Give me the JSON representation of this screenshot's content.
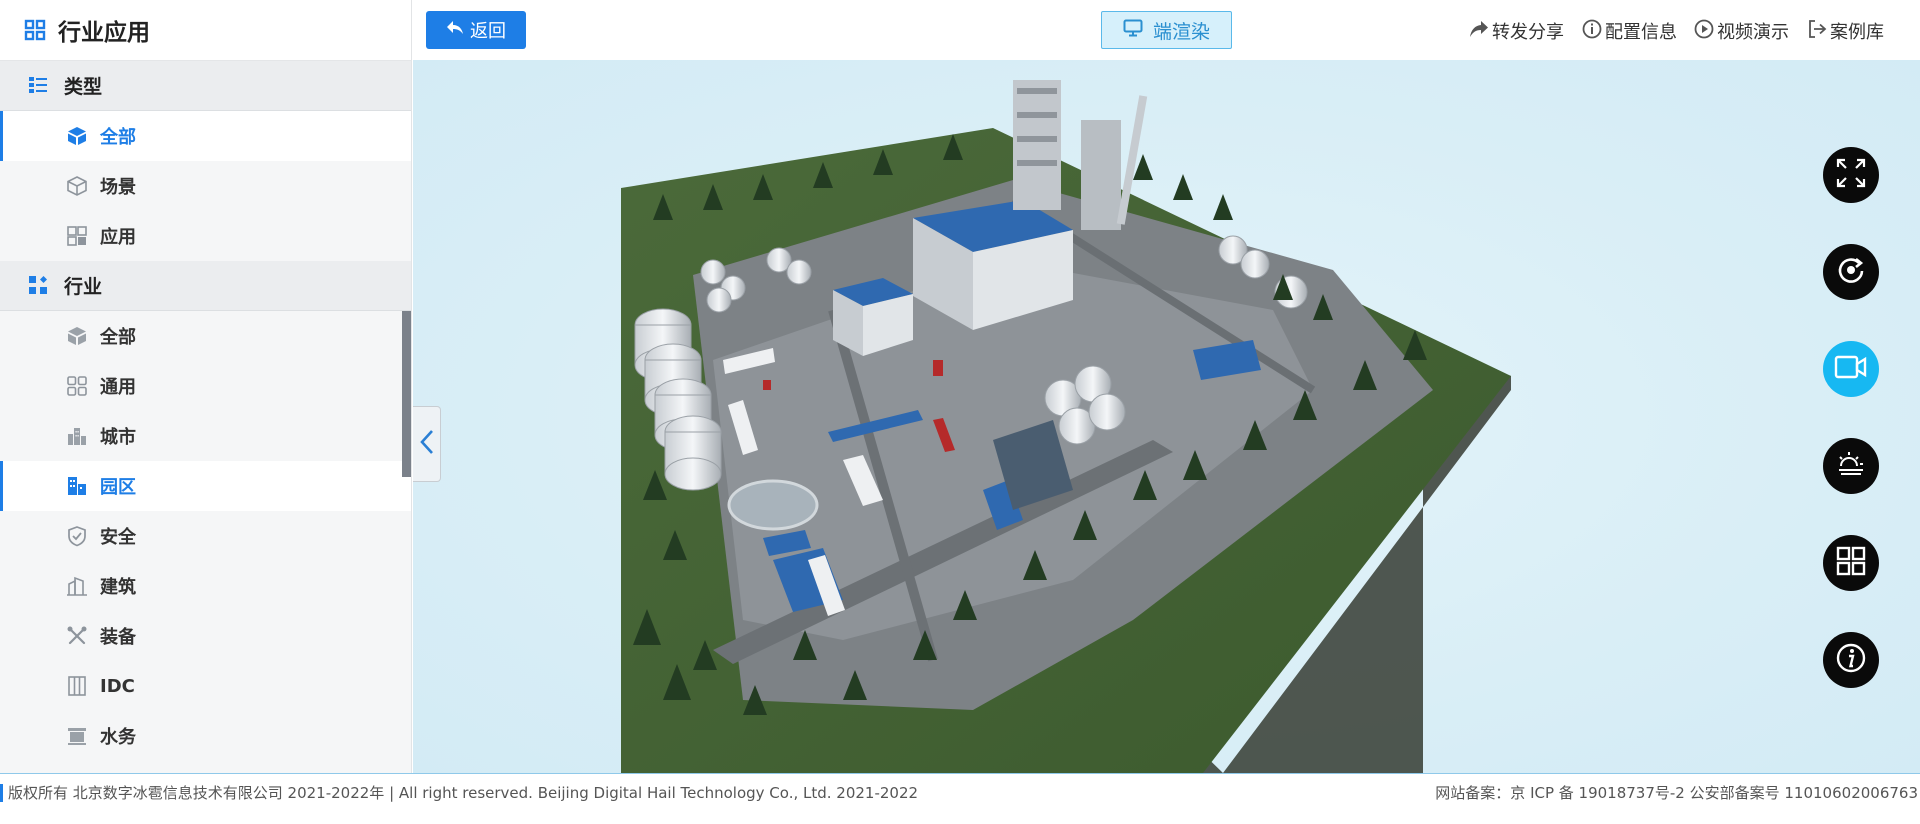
{
  "sidebar": {
    "title": "行业应用",
    "sections": [
      {
        "label": "类型",
        "items": [
          {
            "label": "全部",
            "icon": "cube-icon",
            "active": true
          },
          {
            "label": "场景",
            "icon": "cube-outline-icon",
            "active": false
          },
          {
            "label": "应用",
            "icon": "grid-icon",
            "active": false
          }
        ]
      },
      {
        "label": "行业",
        "items": [
          {
            "label": "全部",
            "icon": "cube-icon",
            "active": false
          },
          {
            "label": "通用",
            "icon": "four-squares-icon",
            "active": false
          },
          {
            "label": "城市",
            "icon": "city-icon",
            "active": false
          },
          {
            "label": "园区",
            "icon": "park-icon",
            "active": true
          },
          {
            "label": "安全",
            "icon": "shield-icon",
            "active": false
          },
          {
            "label": "建筑",
            "icon": "building-icon",
            "active": false
          },
          {
            "label": "装备",
            "icon": "tools-icon",
            "active": false
          },
          {
            "label": "IDC",
            "icon": "server-icon",
            "active": false
          },
          {
            "label": "水务",
            "icon": "water-icon",
            "active": false
          }
        ]
      }
    ]
  },
  "toolbar": {
    "back_label": "返回",
    "render_label": "端渲染",
    "links": {
      "share": "转发分享",
      "config": "配置信息",
      "video": "视频演示",
      "library": "案例库"
    }
  },
  "viewport": {
    "scene_icon": "industrial-park-3d-scene",
    "controls": [
      "fullscreen-icon",
      "rotate-icon",
      "video-camera-icon",
      "weather-icon",
      "layout-grid-icon",
      "info-icon"
    ]
  },
  "footer": {
    "copyright": "版权所有 北京数字冰雹信息技术有限公司 2021-2022年 | All right reserved. Beijing Digital Hail Technology Co., Ltd. 2021-2022",
    "beian": "网站备案：京 ICP 备 19018737号-2 公安部备案号 11010602006763"
  },
  "colors": {
    "accent": "#1e7ee6",
    "active_control": "#17b8f2",
    "viewport_bg": "#d9eef6"
  }
}
